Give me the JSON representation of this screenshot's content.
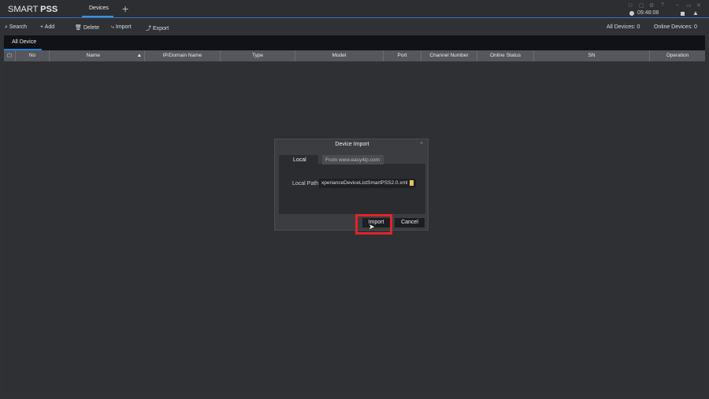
{
  "app": {
    "logo_light": "SMART ",
    "logo_bold": "PSS",
    "tab": "Devices",
    "add_tab": "+",
    "time": "09:48:08"
  },
  "toolbar": {
    "search": "Search",
    "add": "Add",
    "delete": "Delete",
    "import": "Import",
    "export": "Export",
    "all_devices_label": "All Devices:",
    "all_devices": "0",
    "online_devices_label": "Online Devices:",
    "online_devices": "0"
  },
  "tabs": {
    "all_device": "All Device"
  },
  "table": {
    "columns": [
      "No",
      "Name",
      "IP/Domain Name",
      "Type",
      "Model",
      "Port",
      "Channel Number",
      "Online Status",
      "SN",
      "Operation"
    ]
  },
  "dialog": {
    "title": "Device Import",
    "close": "×",
    "tab_local": "Local",
    "tab_web": "From www.easy4ip.com",
    "local_path_label": "Local Path",
    "local_path_value": "xperianceDeviceListSmartPSS2.0.xml",
    "import": "Import",
    "cancel": "Cancel"
  }
}
